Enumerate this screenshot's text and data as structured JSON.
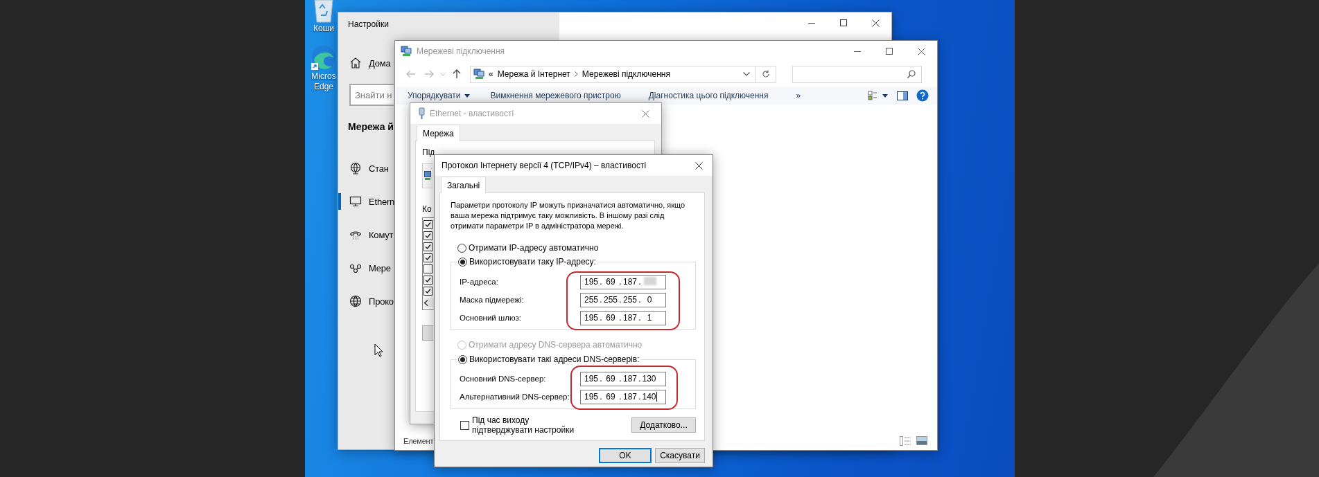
{
  "desktop_icons": [
    {
      "kind": "recycle-bin",
      "lines": [
        "Коши"
      ]
    },
    {
      "kind": "browser",
      "lines": [
        "Micros",
        "Edge"
      ]
    }
  ],
  "settings_window": {
    "title": "Настройки",
    "home": "Дома",
    "search": {
      "placeholder": "Знайти н"
    },
    "section": "Мережа й",
    "nav_items": [
      {
        "kind": "status",
        "label": "Стан",
        "selected": false
      },
      {
        "kind": "ethernet",
        "label": "Ethern",
        "selected": true
      },
      {
        "kind": "dialup",
        "label": "Комут",
        "selected": false
      },
      {
        "kind": "vpn",
        "label": "Мере",
        "selected": false
      },
      {
        "kind": "proxy",
        "label": "Проко",
        "selected": false
      }
    ]
  },
  "network_window": {
    "title": "Мережеві підключення",
    "address": {
      "overflow": "«",
      "path": [
        "Мережа й Інтернет",
        "Мережеві підключення"
      ]
    },
    "toolbar": [
      {
        "label": "Упорядкувати",
        "dropdown": true
      },
      {
        "label": "Вимкнення мережевого пристрою",
        "dropdown": false
      },
      {
        "label": "Діагностика цього підключення",
        "dropdown": false
      }
    ],
    "more": "»",
    "status": "Елемент"
  },
  "ethernet_window": {
    "title": "Ethernet - властивості",
    "tabs": [
      {
        "label": "Мережа",
        "selected": true
      }
    ],
    "connect_label": "Під",
    "components_label": "Ко",
    "components": [
      {
        "checked": true
      },
      {
        "checked": true
      },
      {
        "checked": true
      },
      {
        "checked": true
      },
      {
        "checked": false
      },
      {
        "checked": true
      },
      {
        "checked": true
      }
    ]
  },
  "ipv4_dialog": {
    "title": "Протокол Інтернету версії 4 (TCP/IPv4) – властивості",
    "tabs": [
      {
        "label": "Загальні",
        "selected": true
      }
    ],
    "description": "Параметри протоколу IP можуть призначатися автоматично, якщо ваша мережа підтримує таку можливість. В іншому разі слід отримати параметри IP в адміністратора мережі.",
    "octet_separator": ".",
    "ip_mode": [
      {
        "label": "Отримати IP-адресу автоматично",
        "selected": false
      },
      {
        "label": "Використовувати таку IP-адресу:",
        "selected": true
      }
    ],
    "ip_fields": [
      {
        "label": "IP-адреса:",
        "octets": [
          "195",
          "69",
          "187"
        ],
        "blurred_last": true
      },
      {
        "label": "Маска підмережі:",
        "octets": [
          "255",
          "255",
          "255",
          "0"
        ],
        "blurred_last": false
      },
      {
        "label": "Основний шлюз:",
        "octets": [
          "195",
          "69",
          "187",
          "1"
        ],
        "blurred_last": false
      }
    ],
    "dns_mode": [
      {
        "label": "Отримати адресу DNS-сервера автоматично",
        "selected": false,
        "disabled": true
      },
      {
        "label": "Використовувати такі адреси DNS-серверів:",
        "selected": true,
        "disabled": false
      }
    ],
    "dns_fields": [
      {
        "label": "Основний DNS-сервер:",
        "octets": [
          "195",
          "69",
          "187",
          "130"
        ],
        "focused": false
      },
      {
        "label": "Альтернативний DNS-сервер:",
        "octets": [
          "195",
          "69",
          "187",
          "140"
        ],
        "focused": true
      }
    ],
    "validate": {
      "label": "Під час виходу підтверджувати настройки",
      "checked": false
    },
    "advanced": "Додатково...",
    "buttons": [
      {
        "label": "OK",
        "default": true
      },
      {
        "label": "Скасувати",
        "default": false
      }
    ]
  }
}
